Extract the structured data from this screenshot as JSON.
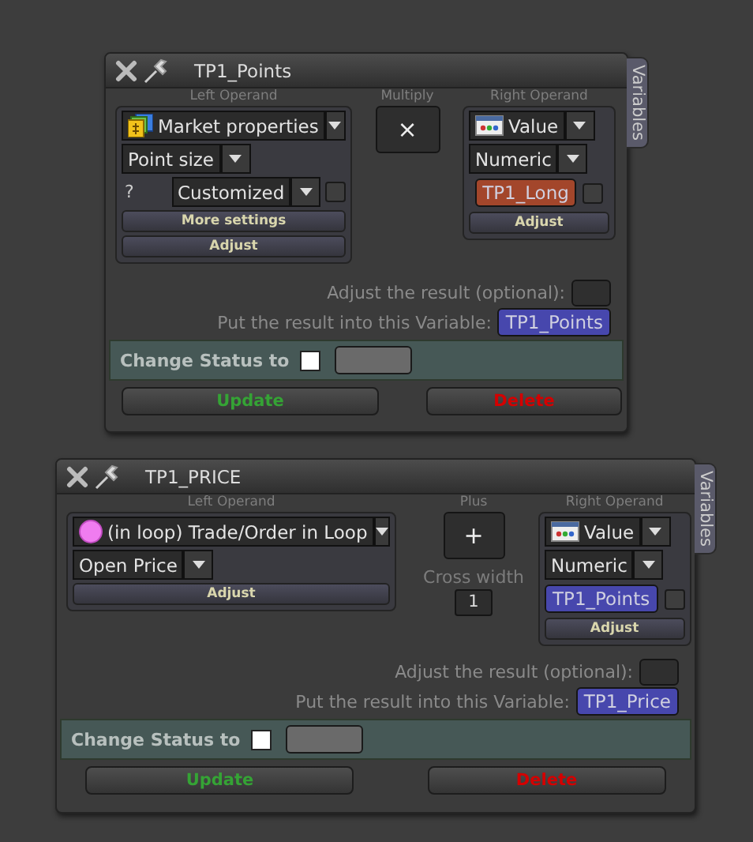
{
  "dialogs": [
    {
      "title": "TP1_Points",
      "side_tab": "Variables",
      "left_operand": {
        "label": "Left Operand",
        "source": {
          "text": "Market properties",
          "kind": "market"
        },
        "property": "Point size",
        "option": {
          "prefix": "?",
          "value": "Customized",
          "checked": false
        },
        "buttons": [
          "More settings",
          "Adjust"
        ]
      },
      "operator": {
        "label": "Multiply",
        "symbol": "×"
      },
      "right_operand": {
        "label": "Right Operand",
        "type": "Value",
        "format": "Numeric",
        "variable": {
          "text": "TP1_Long",
          "color": "#a3462b"
        },
        "checked": false,
        "button": "Adjust"
      },
      "adjust_label": "Adjust the result (optional):",
      "result_label": "Put the result into this Variable:",
      "result_variable": "TP1_Points",
      "status": {
        "label": "Change Status to",
        "checked": false
      },
      "update": "Update",
      "delete": "Delete"
    },
    {
      "title": "TP1_PRICE",
      "side_tab": "Variables",
      "left_operand": {
        "label": "Left Operand",
        "source": {
          "text": "(in loop) Trade/Order in Loop",
          "kind": "loop"
        },
        "property": "Open Price",
        "buttons": [
          "Adjust"
        ]
      },
      "operator": {
        "label": "Plus",
        "symbol": "+",
        "cross_width": {
          "label": "Cross width",
          "value": "1"
        }
      },
      "right_operand": {
        "label": "Right Operand",
        "type": "Value",
        "format": "Numeric",
        "variable": {
          "text": "TP1_Points",
          "color": "#4747ad"
        },
        "checked": false,
        "button": "Adjust"
      },
      "adjust_label": "Adjust the result (optional):",
      "result_label": "Put the result into this Variable:",
      "result_variable": "TP1_Price",
      "status": {
        "label": "Change Status to",
        "checked": false
      },
      "update": "Update",
      "delete": "Delete"
    }
  ]
}
